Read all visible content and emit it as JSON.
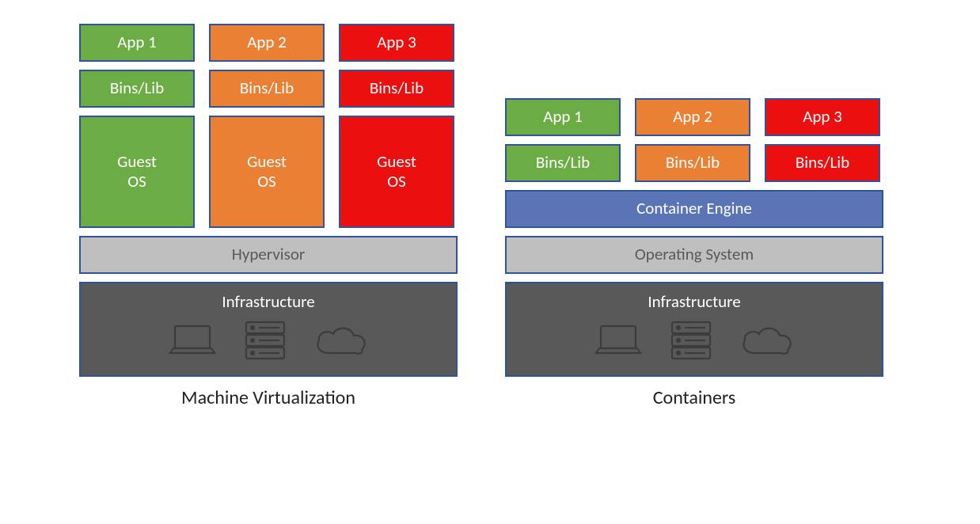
{
  "vm": {
    "caption": "Machine Virtualization",
    "apps": [
      "App 1",
      "App 2",
      "App 3"
    ],
    "bins": [
      "Bins/Lib",
      "Bins/Lib",
      "Bins/Lib"
    ],
    "guests": [
      "Guest\nOS",
      "Guest\nOS",
      "Guest\nOS"
    ],
    "hypervisor": "Hypervisor",
    "infrastructure": "Infrastructure"
  },
  "ct": {
    "caption": "Containers",
    "apps": [
      "App 1",
      "App 2",
      "App 3"
    ],
    "bins": [
      "Bins/Lib",
      "Bins/Lib",
      "Bins/Lib"
    ],
    "engine": "Container Engine",
    "os": "Operating System",
    "infrastructure": "Infrastructure"
  },
  "colors": {
    "green": "#6bac44",
    "orange": "#e98033",
    "red": "#eb0f0f",
    "blue": "#5a74b5",
    "lightgray": "#bfbfbf",
    "darkgray": "#595959",
    "border": "#2f5597"
  }
}
